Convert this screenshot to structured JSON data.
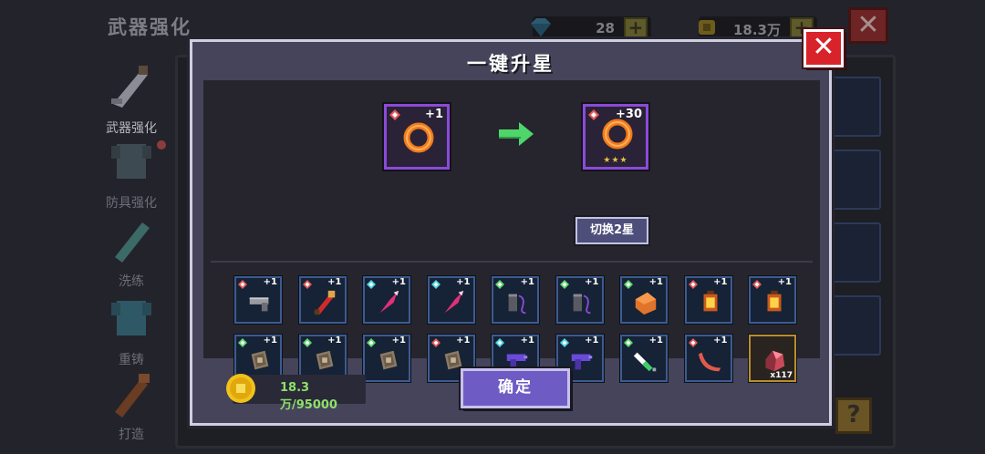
{
  "background": {
    "title": "武器强化",
    "gems": "28",
    "gold": "18.3万",
    "sidebar": [
      {
        "label": "武器强化",
        "icon": "sword-icon",
        "active": true
      },
      {
        "label": "防具强化",
        "icon": "armor-icon",
        "active": false
      },
      {
        "label": "洗练",
        "icon": "reforge-icon",
        "active": false
      },
      {
        "label": "重铸",
        "icon": "recast-icon",
        "active": false
      },
      {
        "label": "打造",
        "icon": "craft-icon",
        "active": false
      }
    ],
    "close_symbol": "✕",
    "help_symbol": "?",
    "plus_symbol": "+"
  },
  "modal": {
    "title": "一键升星",
    "close_symbol": "✕",
    "from_item": {
      "level": "+1",
      "icon": "ring-icon"
    },
    "to_item": {
      "level": "+30",
      "icon": "ring-icon",
      "stars": "★★★"
    },
    "switch_label": "切换2星",
    "items": [
      {
        "icon": "pistol-icon",
        "gem": "red",
        "level": "+1"
      },
      {
        "icon": "red-sword-icon",
        "gem": "red",
        "level": "+1"
      },
      {
        "icon": "pink-drill-icon",
        "gem": "cyan",
        "level": "+1"
      },
      {
        "icon": "pink-drill-icon",
        "gem": "cyan",
        "level": "+1"
      },
      {
        "icon": "canister-icon",
        "gem": "green",
        "level": "+1"
      },
      {
        "icon": "canister-icon",
        "gem": "green",
        "level": "+1"
      },
      {
        "icon": "orange-crate-icon",
        "gem": "green",
        "level": "+1"
      },
      {
        "icon": "lantern-icon",
        "gem": "red",
        "level": "+1"
      },
      {
        "icon": "lantern-icon",
        "gem": "red",
        "level": "+1"
      },
      {
        "icon": "tablet-icon",
        "gem": "green",
        "level": "+1"
      },
      {
        "icon": "tablet-icon",
        "gem": "green",
        "level": "+1"
      },
      {
        "icon": "tablet-icon",
        "gem": "green",
        "level": "+1"
      },
      {
        "icon": "tablet-icon",
        "gem": "red",
        "level": "+1"
      },
      {
        "icon": "purple-gun-icon",
        "gem": "cyan",
        "level": "+1"
      },
      {
        "icon": "purple-gun-icon",
        "gem": "cyan",
        "level": "+1"
      },
      {
        "icon": "syringe-icon",
        "gem": "green",
        "level": "+1"
      },
      {
        "icon": "boomerang-icon",
        "gem": "red",
        "level": "+1"
      },
      {
        "icon": "ore-icon",
        "count": "x117",
        "rarity": "gold"
      }
    ],
    "coin_text": "18.3万/95000",
    "confirm_label": "确定"
  },
  "colors": {
    "accent_purple": "#6e5cc4",
    "close_red": "#d9232b",
    "coin_green": "#8ee069",
    "slot_border_blue": "#3d5b8f",
    "slot_border_gold": "#b98e2c",
    "preview_border_purple": "#8a4bd8"
  }
}
